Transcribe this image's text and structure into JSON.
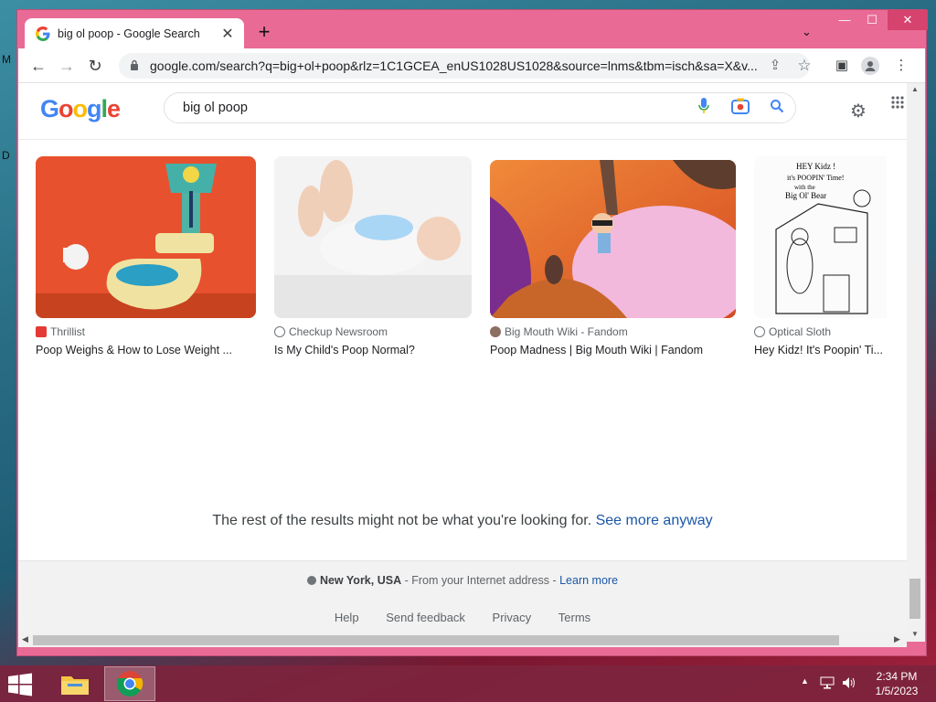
{
  "desktop": {
    "edge_letter_1": "M",
    "edge_letter_2": "D"
  },
  "browser": {
    "tab_title": "big ol poop - Google Search",
    "tab_close": "✕",
    "new_tab": "+",
    "tab_search": "⌄",
    "controls": {
      "minimize": "—",
      "maximize": "☐",
      "close": "✕"
    },
    "nav": {
      "back": "←",
      "forward": "→",
      "reload": "↻"
    },
    "url": "google.com/search?q=big+ol+poop&rlz=1C1GCEA_enUS1028US1028&source=lnms&tbm=isch&sa=X&v...",
    "omni_icons": {
      "share": "⇪",
      "bookmark": "☆",
      "side_panel": "▣",
      "menu": "⋮"
    }
  },
  "google": {
    "logo_letters": [
      "G",
      "o",
      "o",
      "g",
      "l",
      "e"
    ],
    "logo_colors": [
      "#4285f4",
      "#ea4335",
      "#fbbc05",
      "#4285f4",
      "#34a853",
      "#ea4335"
    ],
    "query": "big ol poop",
    "settings_icon": "⚙",
    "apps_icon": "⋮⋮"
  },
  "results": [
    {
      "source": "Thrillist",
      "title": "Poop Weighs & How to Lose Weight ...",
      "source_color": "#e53935"
    },
    {
      "source": "Checkup Newsroom",
      "title": "Is My Child's Poop Normal?",
      "source_color": "#70757a"
    },
    {
      "source": "Big Mouth Wiki - Fandom",
      "title": "Poop Madness | Big Mouth Wiki | Fandom",
      "source_color": "#8d6e63"
    },
    {
      "source": "Optical Sloth",
      "title": "Hey Kidz! It's Poopin' Ti...",
      "source_color": "#70757a"
    }
  ],
  "sketch_text": {
    "line1": "HEY Kidz !",
    "line2": "it's POOPIN' Time!",
    "line3": "with the",
    "line4": "Big Ol' Bear"
  },
  "notice": {
    "text": "The rest of the results might not be what you're looking for.",
    "link": "See more anyway"
  },
  "footer": {
    "location": "New York, USA",
    "location_sep": " - From your Internet address - ",
    "learn_more": "Learn more",
    "links": [
      "Help",
      "Send feedback",
      "Privacy",
      "Terms"
    ]
  },
  "taskbar": {
    "time": "2:34 PM",
    "date": "1/5/2023"
  }
}
